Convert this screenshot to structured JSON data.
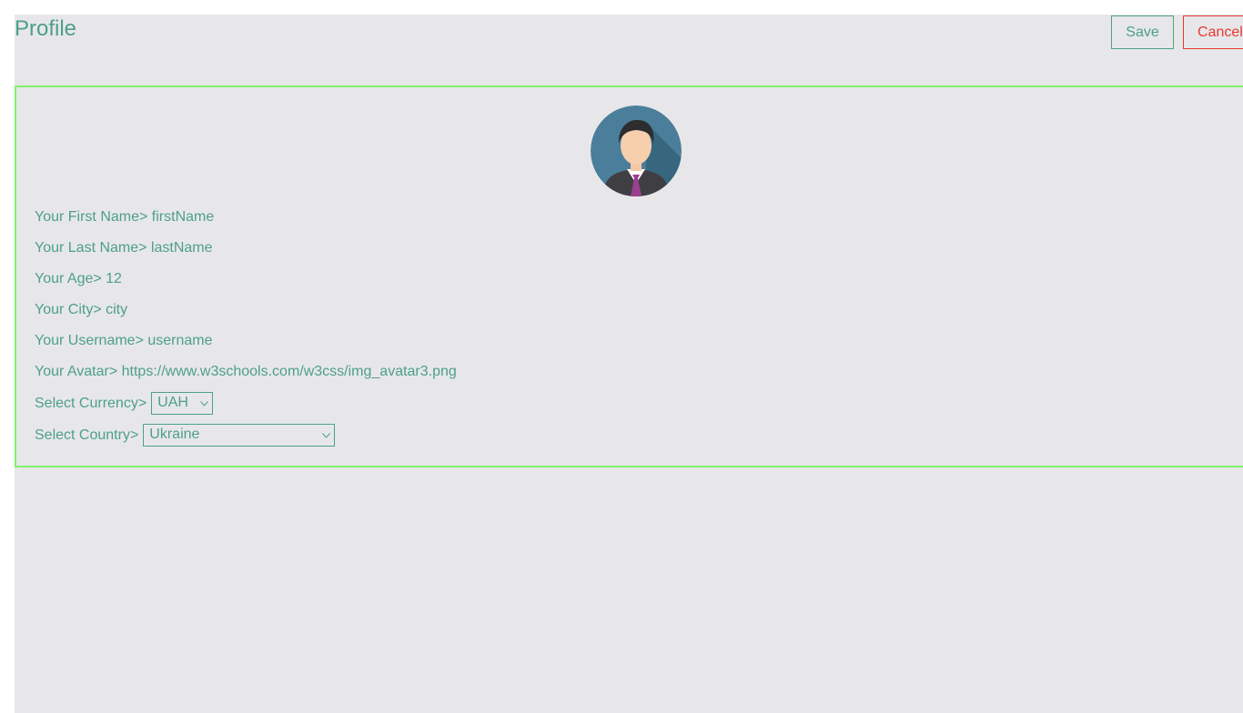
{
  "header": {
    "title": "Profile",
    "save_label": "Save",
    "cancel_label": "Cancel"
  },
  "profile": {
    "avatar_icon": "user-avatar-icon",
    "fields": [
      {
        "label": "Your First Name>",
        "value": "firstName"
      },
      {
        "label": "Your Last Name>",
        "value": "lastName"
      },
      {
        "label": "Your Age>",
        "value": "12"
      },
      {
        "label": "Your City>",
        "value": "city"
      },
      {
        "label": "Your Username>",
        "value": "username"
      },
      {
        "label": "Your Avatar>",
        "value": "https://www.w3schools.com/w3css/img_avatar3.png"
      }
    ],
    "currency": {
      "label": "Select Currency>",
      "selected": "UAH"
    },
    "country": {
      "label": "Select Country>",
      "selected": "Ukraine"
    }
  },
  "colors": {
    "accent": "#4e9f8a",
    "danger": "#e8372e",
    "card_border": "#82f06b",
    "background": "#e7e7e9"
  }
}
